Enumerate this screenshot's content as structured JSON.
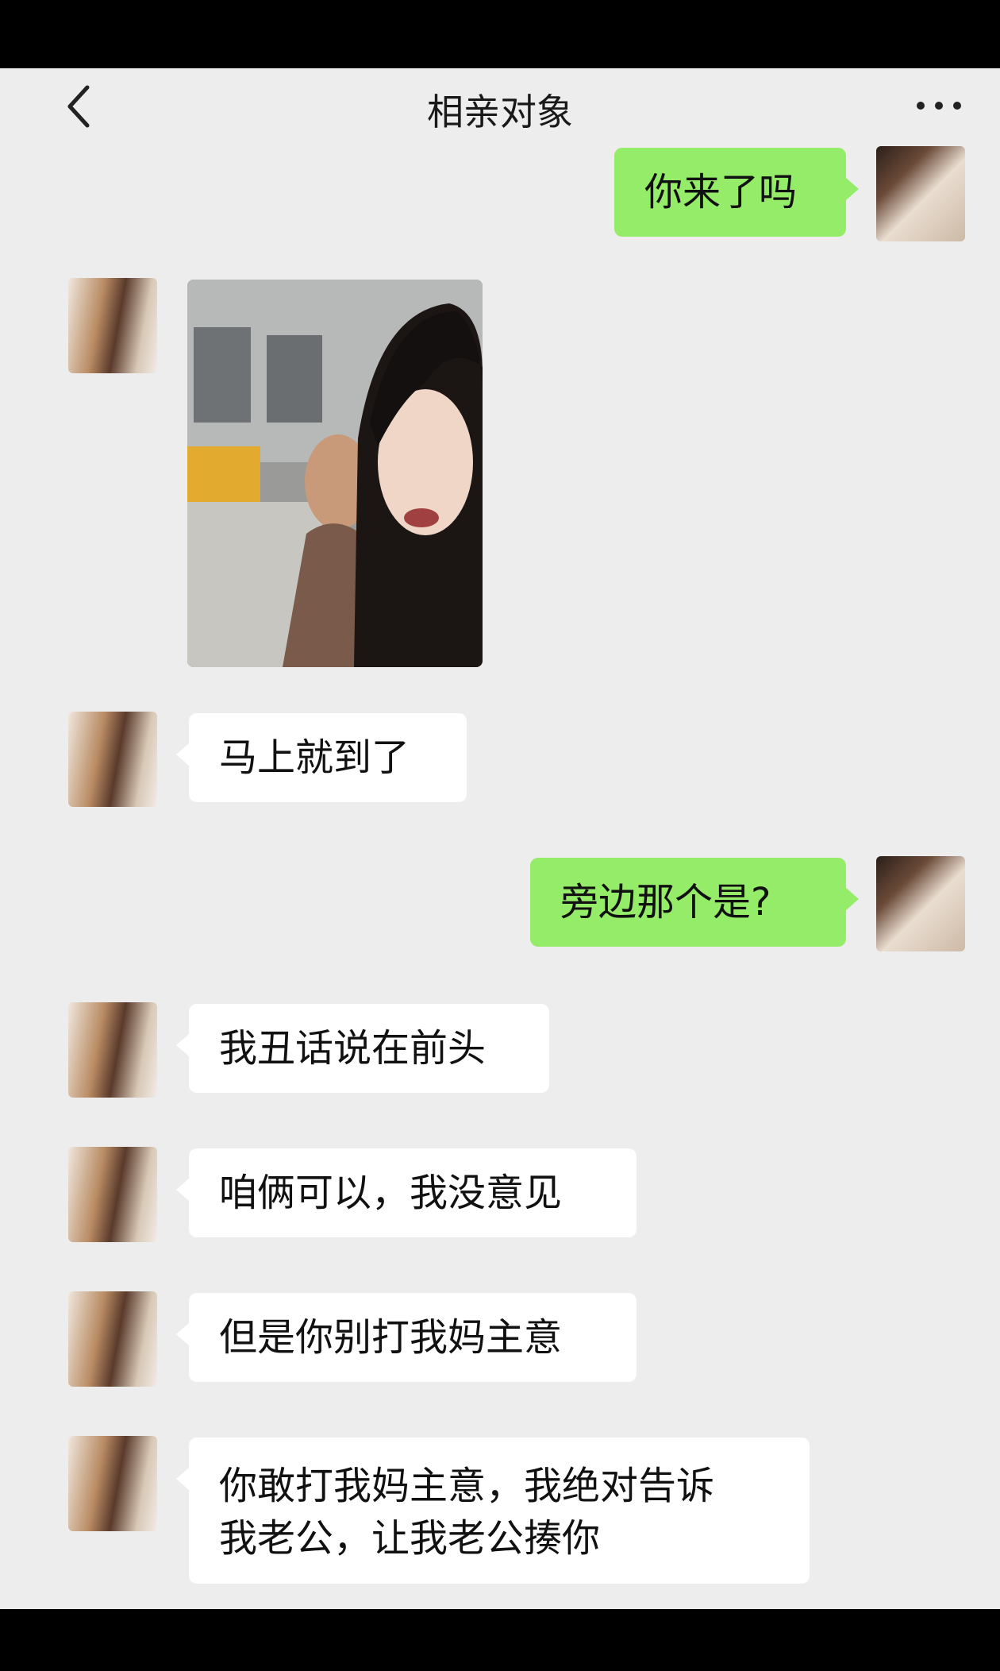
{
  "header": {
    "title": "相亲对象",
    "back_icon": "chevron-left-icon",
    "more_icon": "more-dots-icon"
  },
  "messages": [
    {
      "side": "right",
      "type": "text",
      "text": "你来了吗"
    },
    {
      "side": "left",
      "type": "image",
      "description_icon": "photo-icon"
    },
    {
      "side": "left",
      "type": "text",
      "text": "马上就到了"
    },
    {
      "side": "right",
      "type": "text",
      "text": "旁边那个是?"
    },
    {
      "side": "left",
      "type": "text",
      "text": "我丑话说在前头"
    },
    {
      "side": "left",
      "type": "text",
      "text": "咱俩可以，我没意见"
    },
    {
      "side": "left",
      "type": "text",
      "text": "但是你别打我妈主意"
    },
    {
      "side": "left",
      "type": "text",
      "text": "你敢打我妈主意，我绝对告诉\n我老公，让我老公揍你"
    }
  ],
  "colors": {
    "background": "#ededed",
    "bubble_green": "#95ec69",
    "bubble_white": "#ffffff"
  }
}
